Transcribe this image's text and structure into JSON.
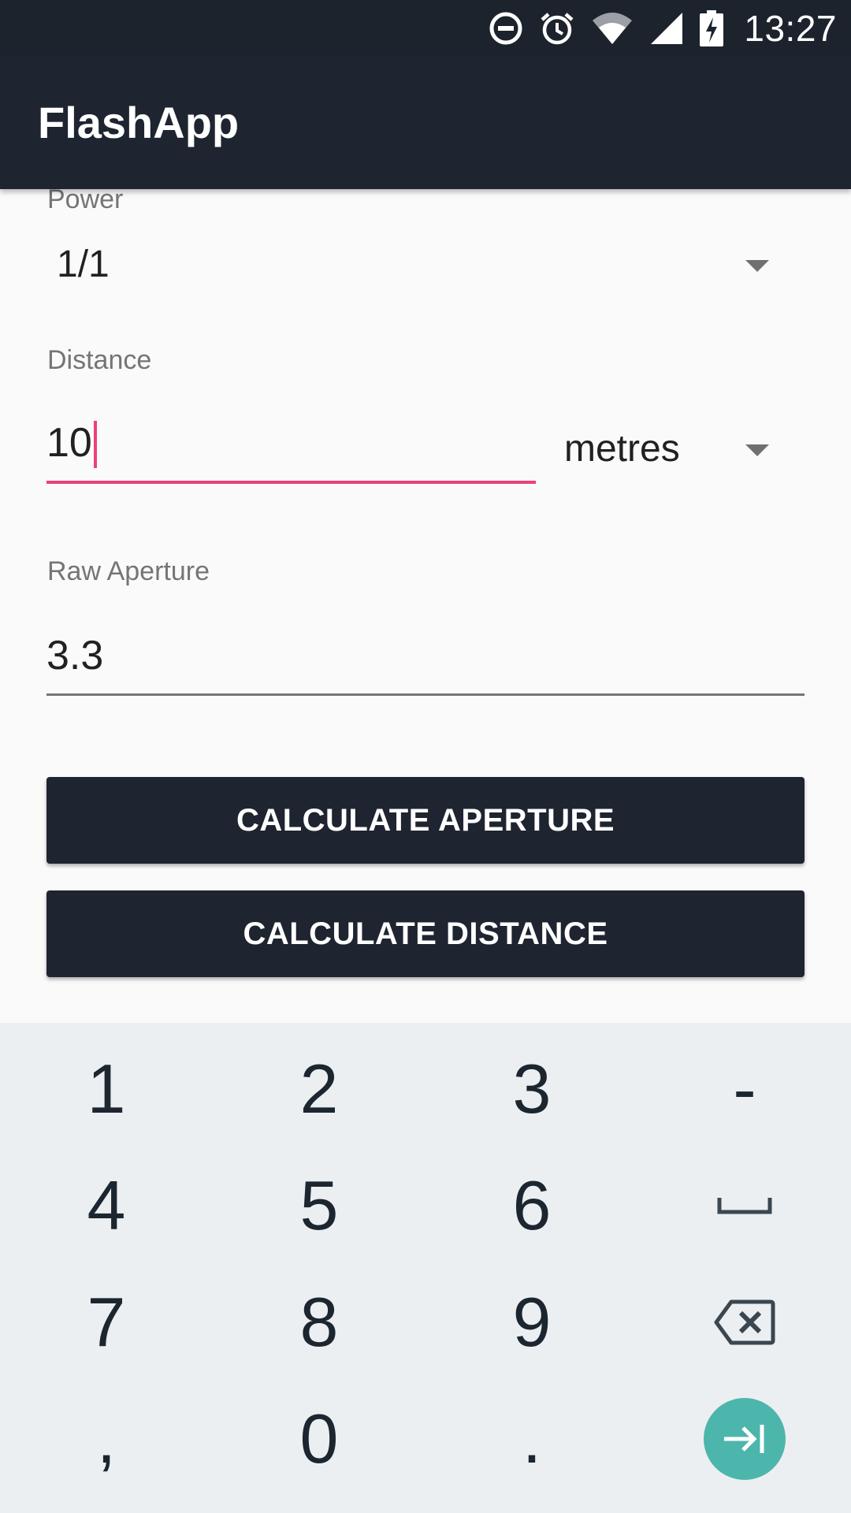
{
  "status_bar": {
    "time": "13:27",
    "icons": [
      "do-not-disturb-icon",
      "alarm-icon",
      "wifi-icon",
      "cell-signal-icon",
      "battery-charging-icon"
    ]
  },
  "app_bar": {
    "title": "FlashApp"
  },
  "form": {
    "power": {
      "label": "Power",
      "value": "1/1"
    },
    "distance": {
      "label": "Distance",
      "value": "10",
      "unit": "metres"
    },
    "raw_aperture": {
      "label": "Raw Aperture",
      "value": "3.3"
    },
    "accent_color": "#ec407a"
  },
  "buttons": {
    "calculate_aperture": "CALCULATE APERTURE",
    "calculate_distance": "CALCULATE DISTANCE"
  },
  "keyboard": {
    "rows": [
      [
        "1",
        "2",
        "3",
        "-"
      ],
      [
        "4",
        "5",
        "6",
        "space-icon"
      ],
      [
        "7",
        "8",
        "9",
        "backspace-icon"
      ],
      [
        ",",
        "0",
        ".",
        "next-field-icon"
      ]
    ],
    "action_color": "#4db6ac"
  }
}
